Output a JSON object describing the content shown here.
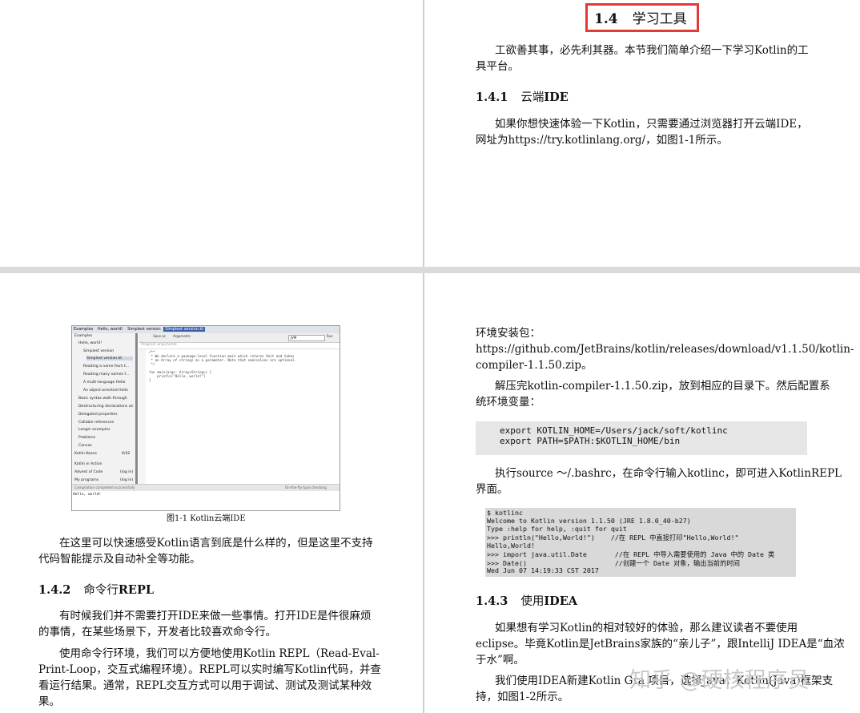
{
  "page_top_right": {
    "section_num": "1.4",
    "section_title": "学习工具",
    "intro": [
      "工欲善其事，必先利其器。本节我们简单介绍一下学习Kotlin的工",
      "具平台。"
    ],
    "sub141_num": "1.4.1",
    "sub141_zh": "云端",
    "sub141_en": "IDE",
    "para141": [
      "如果你想快速体验一下Kotlin，只需要通过浏览器打开云端IDE，",
      "网址为https://try.kotlinlang.org/，如图1-1所示。"
    ]
  },
  "page_bottom_left": {
    "figure": {
      "breadcrumb": [
        "Examples",
        "Hello, world!",
        "Simplest version",
        "Simplest version.kt"
      ],
      "sidebar": [
        "Examples",
        "Hello, world!",
        "Simplest version",
        "Simplest version.kt",
        "Reading a name from t...",
        "Reading many names f...",
        "A multi-language Hello",
        "An object-oriented Hello",
        "Basic syntax walk-through",
        "Destructuring declarations an",
        "Delegated properties",
        "Callable references",
        "Longer examples",
        "Problems",
        "Canvas",
        "Kotlin Koans",
        "Kotlin in Action",
        "Advent of Code",
        "My programs"
      ],
      "koans_count": "0/42",
      "login1": "(log in)",
      "login2": "(log in)",
      "toolbar": [
        "",
        "Save as",
        "Arguments"
      ],
      "platform": "JVM",
      "run": "Run",
      "program_args": "Program arguments",
      "code": [
        "/**",
        " * We declare a package-level function main which returns Unit and takes",
        " * an Array of strings as a parameter. Note that semicolons are optional.",
        " */",
        "",
        "fun main(args: Array<String>) {",
        "    println(\"Hello, world!\")",
        "}"
      ],
      "status_left": "Compilation completed successfully",
      "status_right": "On-the-fly type checking",
      "output": "Hello, world!"
    },
    "caption": "图1-1   Kotlin云端IDE",
    "para1": [
      "在这里可以快速感受Kotlin语言到底是什么样的，但是这里不支持",
      "代码智能提示及自动补全等功能。"
    ],
    "sub142_num": "1.4.2",
    "sub142_zh": "命令行",
    "sub142_en": "REPL",
    "para2": [
      "有时候我们并不需要打开IDE来做一些事情。打开IDE是件很麻烦",
      "的事情，在某些场景下，开发者比较喜欢命令行。"
    ],
    "para3": [
      "使用命令行环境，我们可以方便地使用Kotlin      REPL（Read-Eval-",
      "Print-Loop，交互式编程环境）。REPL可以实时编写Kotlin代码，并查",
      "看运行结果。通常，REPL交互方式可以用于调试、测试及测试某种效",
      "果。"
    ]
  },
  "page_bottom_right": {
    "line1": "环境安装包：",
    "line2": "https://github.com/JetBrains/kotlin/releases/download/v1.1.50/kotlin-",
    "line3": "compiler-1.1.50.zip。",
    "para_a": [
      "解压完kotlin-compiler-1.1.50.zip，放到相应的目录下。然后配置系",
      "统环境变量："
    ],
    "code1": [
      "export KOTLIN_HOME=/Users/jack/soft/kotlinc",
      "export PATH=$PATH:$KOTLIN_HOME/bin"
    ],
    "para_b": [
      "执行source  ～/.bashrc，在命令行输入kotlinc，即可进入KotlinREPL",
      "界面。"
    ],
    "code2": [
      "$ kotlinc",
      "Welcome to Kotlin version 1.1.50 (JRE 1.8.0_40-b27)",
      "Type :help for help, :quit for quit",
      ">>> println(\"Hello,World!\")    //在 REPL 中直接打印\"Hello,World!\"",
      "Hello,World!",
      ">>> import java.util.Date       //在 REPL 中导入需要使用的 Java 中的 Date 类",
      ">>> Date()                      //创建一个 Date 对象，输出当前的时间",
      "Wed Jun 07 14:19:33 CST 2017"
    ],
    "sub143_num": "1.4.3",
    "sub143_zh": "使用",
    "sub143_en": "IDEA",
    "para_c": [
      "如果想有学习Kotlin的相对较好的体验，那么建议读者不要使用",
      "eclipse。毕竟Kotlin是JetBrains家族的“亲儿子”，跟IntelliJ  IDEA是“血浓",
      "于水”啊。"
    ],
    "para_d": [
      "我们使用IDEA新建Kotlin Gra     项目，选择Java，Kotlin(Java)框架支",
      "持，如图1-2所示。"
    ],
    "watermark": "知乎 @硬核程序员"
  }
}
